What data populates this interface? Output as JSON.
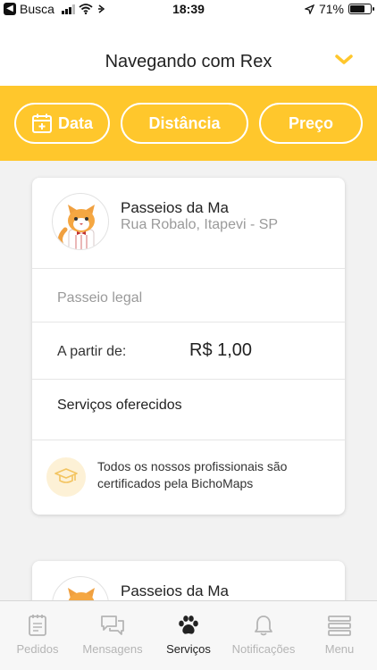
{
  "status_bar": {
    "back_app": "Busca",
    "time": "18:39",
    "battery": "71%",
    "battery_level": 0.71
  },
  "header": {
    "title": "Navegando com Rex",
    "icon": "chevron-down-icon"
  },
  "filters": [
    {
      "label": "Data",
      "icon": "calendar-icon"
    },
    {
      "label": "Distância"
    },
    {
      "label": "Preço"
    }
  ],
  "colors": {
    "accent": "#ffc72c",
    "background": "#f2f2f2",
    "muted_text": "#9a9a9a",
    "inactive_tab": "#b5b5b5"
  },
  "cards": [
    {
      "name": "Passeios da Ma",
      "address": "Rua Robalo, Itapevi - SP",
      "description": "Passeio legal",
      "price_label": "A partir de:",
      "price": "R$ 1,00",
      "services_label": "Serviços oferecidos",
      "certification": "Todos os nossos profissionais são certificados pela BichoMaps",
      "avatar": "cat-avatar-icon"
    },
    {
      "name": "Passeios da Ma",
      "avatar": "cat-avatar-icon"
    }
  ],
  "tabs": [
    {
      "label": "Pedidos",
      "icon": "clipboard-icon",
      "active": false
    },
    {
      "label": "Mensagens",
      "icon": "chat-icon",
      "active": false
    },
    {
      "label": "Serviços",
      "icon": "paw-icon",
      "active": true
    },
    {
      "label": "Notificações",
      "icon": "bell-icon",
      "active": false
    },
    {
      "label": "Menu",
      "icon": "menu-icon",
      "active": false
    }
  ]
}
